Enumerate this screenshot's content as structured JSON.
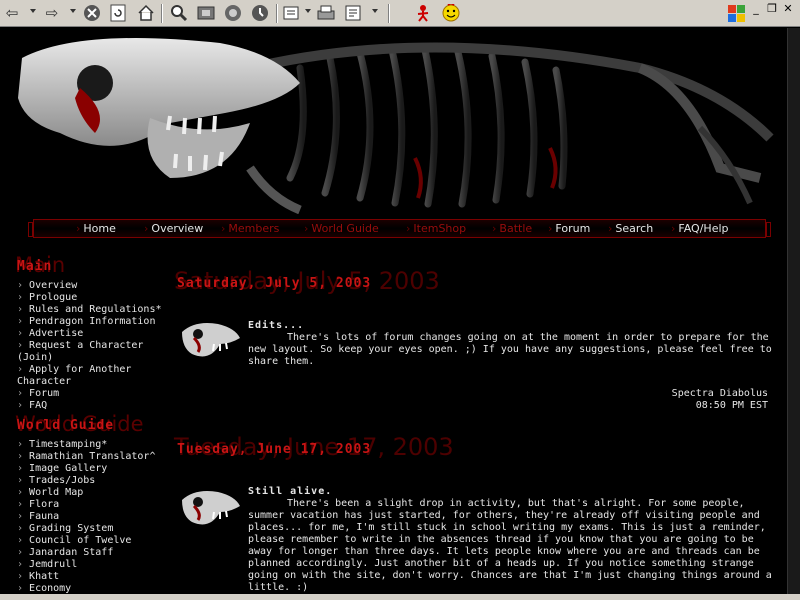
{
  "browser": {
    "toolbar_icons": [
      "back-icon",
      "forward-icon",
      "stop-icon",
      "refresh-icon",
      "home-icon",
      "search-icon",
      "favorites-icon",
      "media-icon",
      "history-icon",
      "mail-icon",
      "print-icon",
      "edit-icon",
      "messenger-icon",
      "smiley-icon"
    ]
  },
  "colors": {
    "accent_red": "#c81414",
    "ghost_red": "#4d0000",
    "text": "#e6e6e6",
    "background": "#000000"
  },
  "nav": {
    "items": [
      {
        "label": "Home",
        "color": "white"
      },
      {
        "label": "Overview",
        "color": "white"
      },
      {
        "label": "Members",
        "color": "red"
      },
      {
        "label": "World Guide",
        "color": "red"
      },
      {
        "label": "ItemShop",
        "color": "red"
      },
      {
        "label": "Battle",
        "color": "red"
      },
      {
        "label": "Forum",
        "color": "white"
      },
      {
        "label": "Search",
        "color": "white"
      },
      {
        "label": "FAQ/Help",
        "color": "white"
      }
    ]
  },
  "sidebar": {
    "main": {
      "ghost": "Main",
      "title": "Main",
      "items": [
        "Overview",
        "Prologue",
        "Rules and Regulations*",
        "Pendragon Information",
        "Advertise",
        "Request a Character (Join)",
        "Apply for Another Character",
        "Forum",
        "FAQ"
      ]
    },
    "world": {
      "ghost": "World Guide",
      "title": "World Guide",
      "items": [
        "Timestamping*",
        "Ramathian Translator^",
        "Image Gallery",
        "Trades/Jobs",
        "World Map",
        "Flora",
        "Fauna",
        "Grading System",
        "Council of Twelve",
        "Janardan Staff",
        "Jemdrull",
        "Khatt",
        "Economy"
      ]
    }
  },
  "posts": [
    {
      "date_ghost": "Saturday, July 5, 2003",
      "date": "Saturday, July 5, 2003",
      "title": "Edits...",
      "body": "There's lots of forum changes going on at the moment in order to prepare for the new layout. So keep your eyes open. ;) If you have any suggestions, please feel free to share them.",
      "author": "Spectra Diabolus",
      "time": "08:50 PM EST"
    },
    {
      "date_ghost": "Tuesday, June 17, 2003",
      "date": "Tuesday, June 17, 2003",
      "title": "Still alive.",
      "body": "There's been a slight drop in activity, but that's alright. For some people, summer vacation has just started, for others, they're already off visiting people and places... for me, I'm still stuck in school writing my exams. This is just a reminder, please remember to write in the absences thread if you know that you are going to be away for longer than three days. It lets people know where you are and threads can be planned accordingly. Just another bit of a heads up. If you notice something strange going on with the site, don't worry. Chances are that I'm just changing things around a little. :)"
    }
  ]
}
